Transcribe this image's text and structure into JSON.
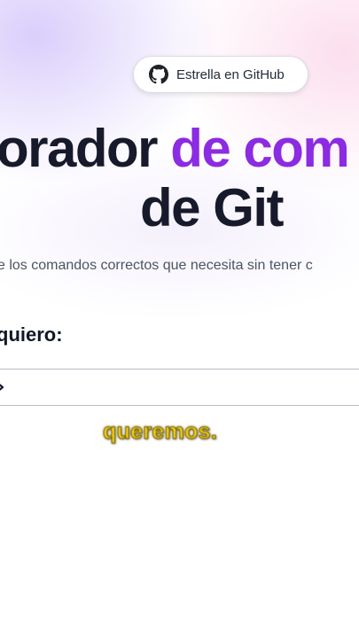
{
  "header": {
    "github_button_label": "Estrella en GitHub",
    "github_icon": "github-icon"
  },
  "hero": {
    "title_line1_part1": "orador ",
    "title_line1_part2": "de com",
    "title_line2": "de Git",
    "subtitle": "e los comandos correctos que necesita sin tener c"
  },
  "form": {
    "label": "quiero:",
    "select_icon": "chevron-right-icon"
  },
  "caption": {
    "text": "queremos."
  },
  "colors": {
    "accent": "#8b2be2",
    "title": "#171a2b",
    "caption": "#f5d21a"
  }
}
